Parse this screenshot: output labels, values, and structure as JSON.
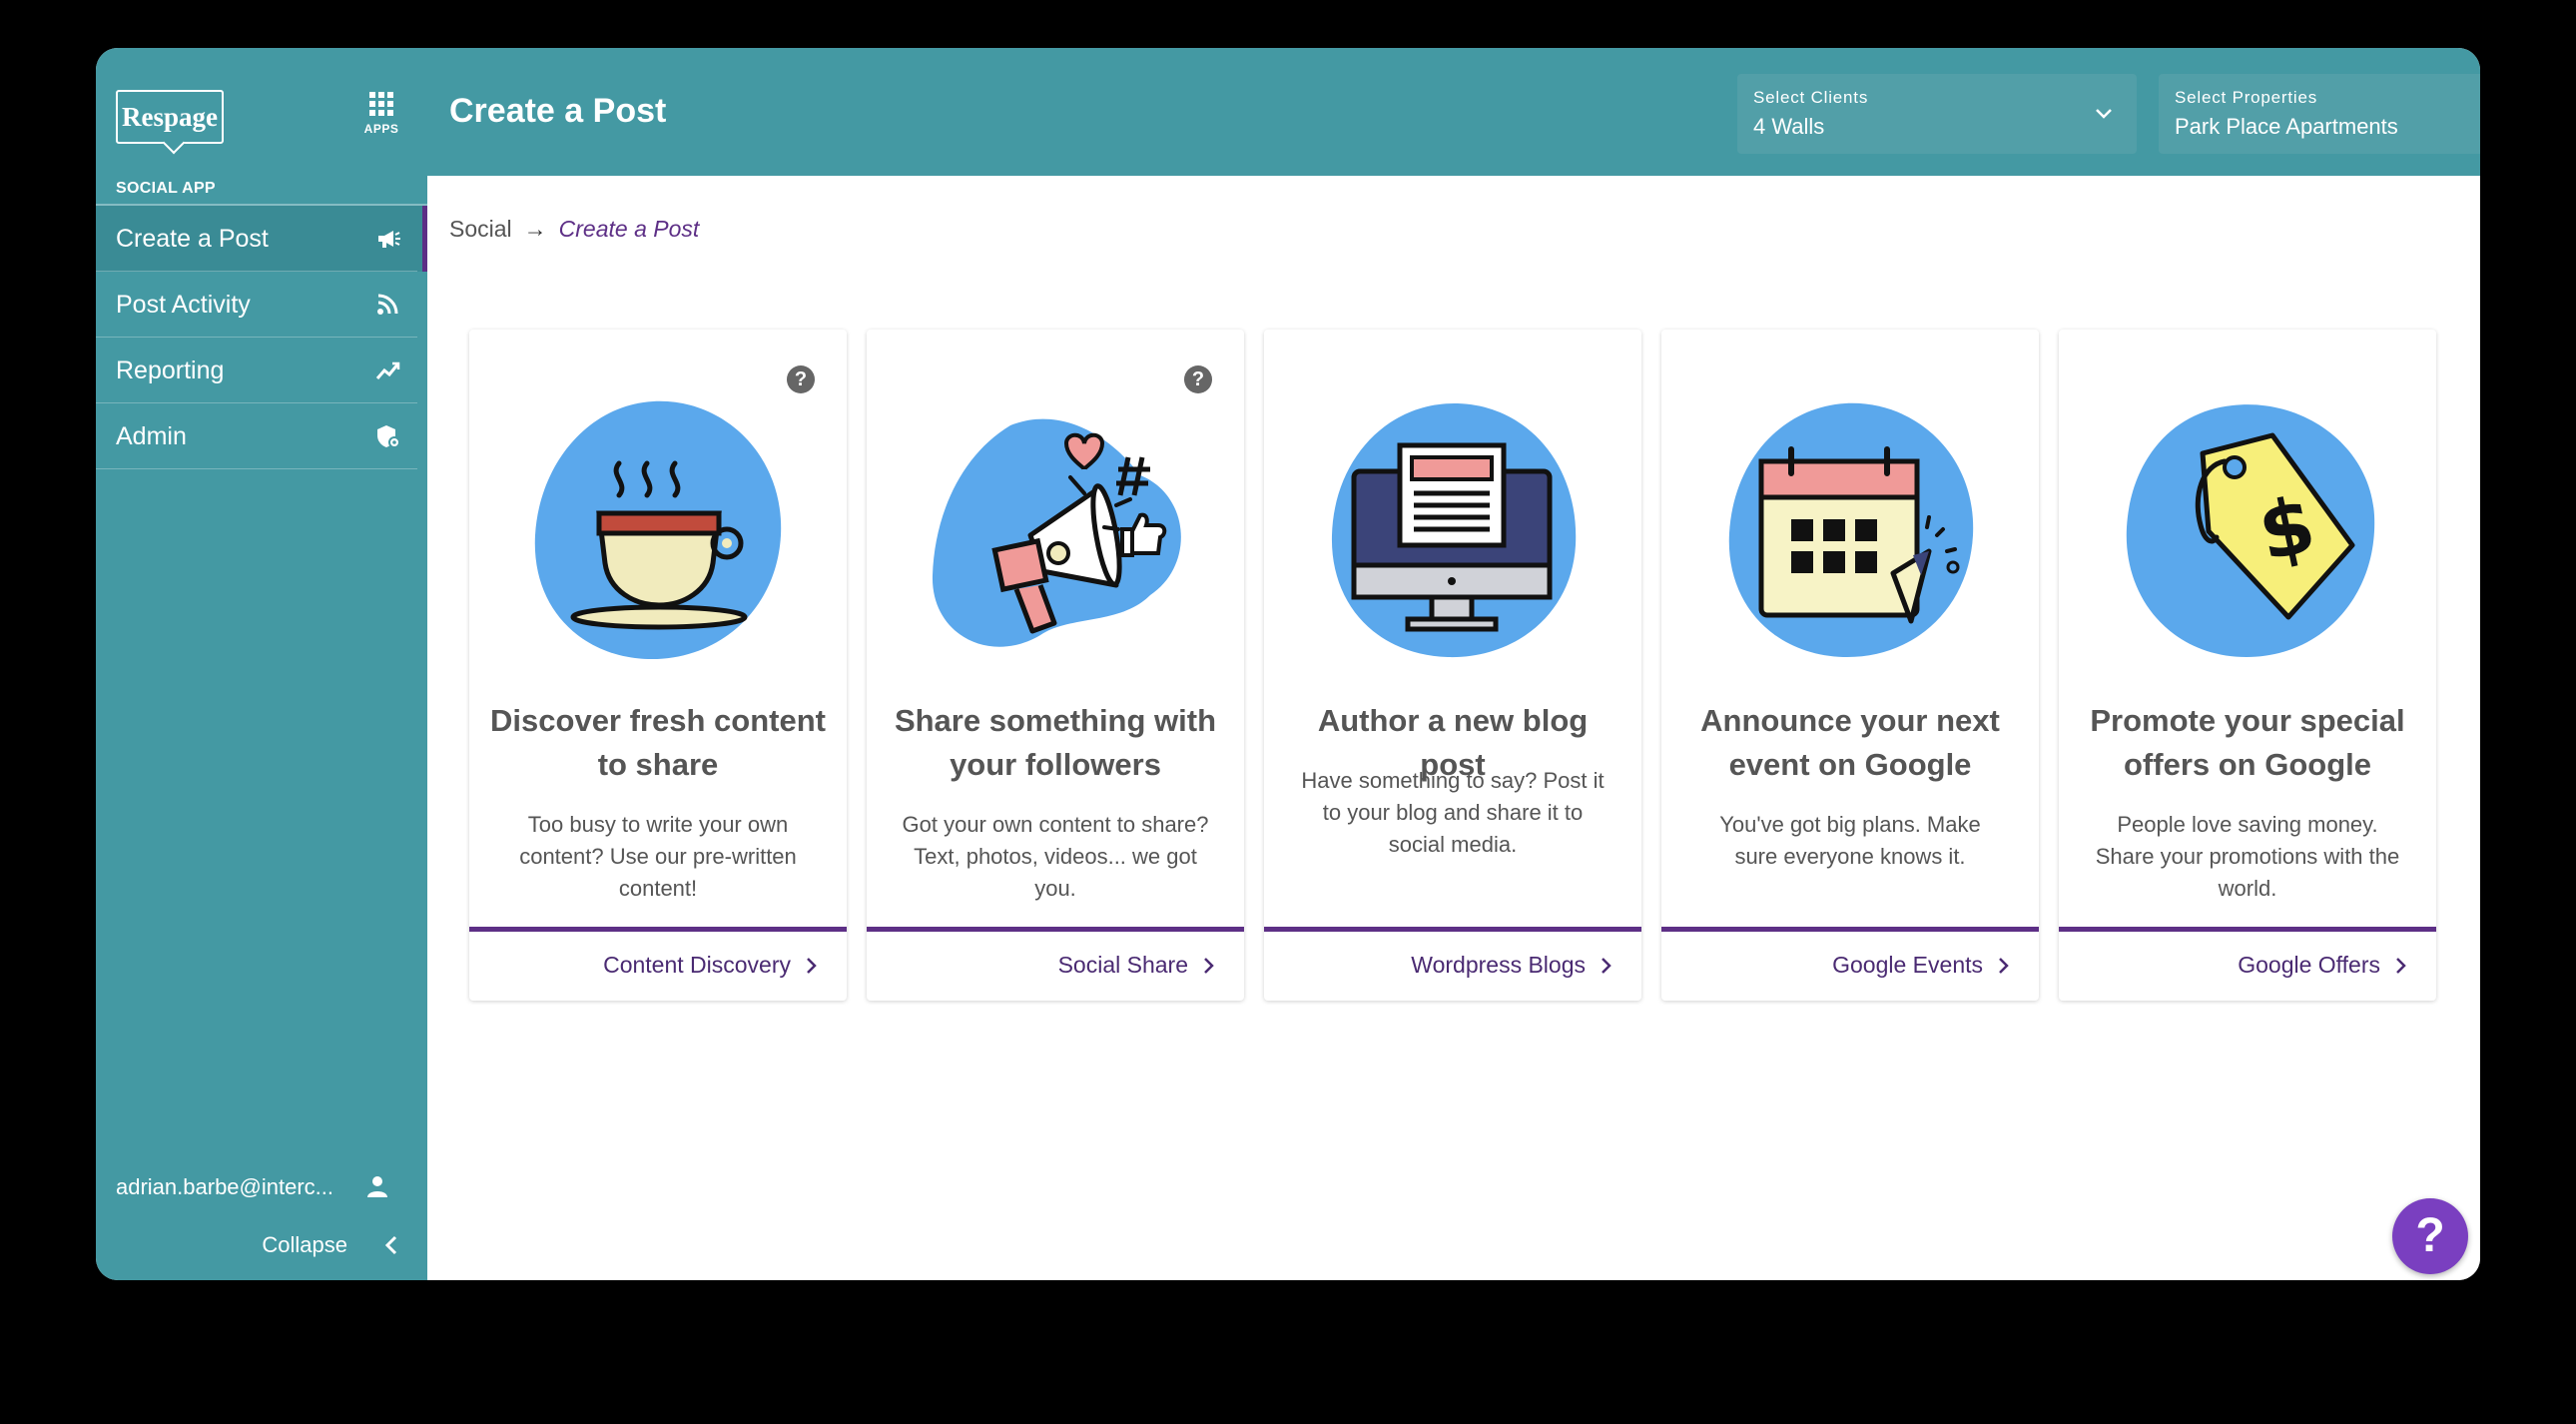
{
  "brand": {
    "logo_text": "Respage",
    "apps_label": "APPS"
  },
  "sidebar": {
    "section_label": "SOCIAL APP",
    "items": [
      {
        "label": "Create a Post",
        "icon": "megaphone-icon",
        "active": true
      },
      {
        "label": "Post Activity",
        "icon": "rss-icon",
        "active": false
      },
      {
        "label": "Reporting",
        "icon": "trend-chart-icon",
        "active": false
      },
      {
        "label": "Admin",
        "icon": "admin-shield-icon",
        "active": false
      }
    ],
    "user": "adrian.barbe@interc...",
    "collapse_label": "Collapse"
  },
  "header": {
    "title": "Create a Post",
    "clients": {
      "label": "Select Clients",
      "value": "4 Walls"
    },
    "properties": {
      "label": "Select Properties",
      "value": "Park Place Apartments"
    }
  },
  "breadcrumb": {
    "root": "Social",
    "arrow": "→",
    "current": "Create a Post"
  },
  "cards": [
    {
      "title": "Discover fresh content to share",
      "description": "Too busy to write your own content? Use our pre-written content!",
      "link": "Content Discovery",
      "help": true,
      "art": "coffee-cup"
    },
    {
      "title": "Share something with your followers",
      "description": "Got your own content to share? Text, photos, videos... we got you.",
      "link": "Social Share",
      "help": true,
      "art": "megaphone"
    },
    {
      "title": "Author a new blog post",
      "description": "Have something to say? Post it to your blog and share it to social media.",
      "link": "Wordpress Blogs",
      "help": false,
      "art": "computer"
    },
    {
      "title": "Announce your next event on Google",
      "description": "You've got big plans. Make sure everyone knows it.",
      "link": "Google Events",
      "help": false,
      "art": "calendar"
    },
    {
      "title": "Promote your special offers on Google",
      "description": "People love saving money. Share your promotions with the world.",
      "link": "Google Offers",
      "help": false,
      "art": "price-tag"
    }
  ],
  "help_symbol": "?",
  "colors": {
    "teal": "#4499a3",
    "purple": "#5d2f86",
    "blob_blue": "#5ba8ec",
    "fab_purple": "#7a3fc0"
  }
}
